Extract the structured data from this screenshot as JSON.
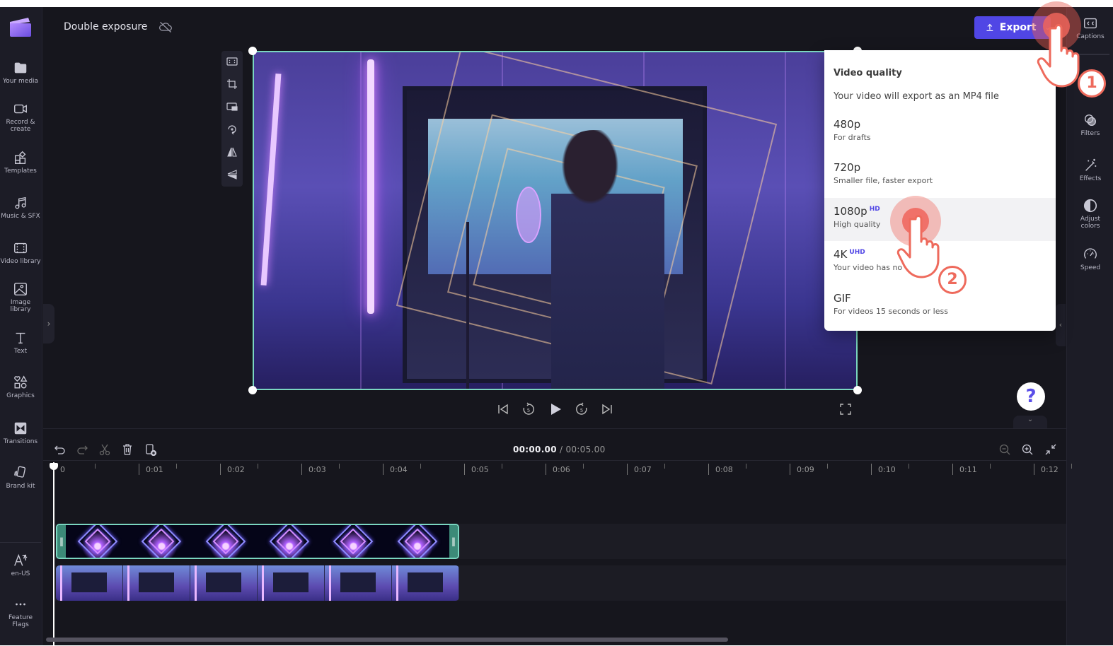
{
  "app": {
    "project_title": "Double exposure",
    "cloud_status_icon": "cloud-off-icon"
  },
  "left_nav": {
    "items": [
      {
        "label": "Your media",
        "icon": "folder-icon"
      },
      {
        "label": "Record & create",
        "icon": "video-camera-icon"
      },
      {
        "label": "Templates",
        "icon": "templates-icon"
      },
      {
        "label": "Music & SFX",
        "icon": "music-note-icon"
      },
      {
        "label": "Video library",
        "icon": "film-icon"
      },
      {
        "label": "Image library",
        "icon": "image-icon"
      },
      {
        "label": "Text",
        "icon": "text-icon"
      },
      {
        "label": "Graphics",
        "icon": "shapes-icon"
      },
      {
        "label": "Transitions",
        "icon": "transitions-icon"
      },
      {
        "label": "Brand kit",
        "icon": "brand-kit-icon"
      }
    ],
    "bottom_items": [
      {
        "label": "en-US",
        "icon": "language-icon"
      },
      {
        "label": "Feature Flags",
        "icon": "more-dots-icon"
      }
    ]
  },
  "header": {
    "export_label": "Export"
  },
  "right_nav": {
    "items": [
      {
        "label": "Captions",
        "icon": "captions-cc-icon"
      },
      {
        "label": "Filters",
        "icon": "filters-icon"
      },
      {
        "label": "Effects",
        "icon": "magic-wand-icon"
      },
      {
        "label": "Adjust colors",
        "icon": "contrast-icon"
      },
      {
        "label": "Speed",
        "icon": "speedometer-icon"
      }
    ]
  },
  "export_menu": {
    "title": "Video quality",
    "subtitle": "Your video will export as an MP4 file",
    "options": [
      {
        "label": "480p",
        "badge": "",
        "description": "For drafts"
      },
      {
        "label": "720p",
        "badge": "",
        "description": "Smaller file, faster export"
      },
      {
        "label": "1080p",
        "badge": "HD",
        "description": "High quality"
      },
      {
        "label": "4K",
        "badge": "UHD",
        "description": "Your video has no"
      },
      {
        "label": "GIF",
        "badge": "",
        "description": "For videos 15 seconds or less"
      }
    ],
    "hovered_option": "1080p"
  },
  "annotations": {
    "step1": "1",
    "step2": "2",
    "accent_color": "#ee6a5c"
  },
  "help": {
    "label": "?"
  },
  "playback": {
    "current_time": "00:00.00",
    "separator": " / ",
    "total_time": "00:05.00"
  },
  "timeline": {
    "ruler_labels": [
      "0",
      "0:01",
      "0:02",
      "0:03",
      "0:04",
      "0:05",
      "0:06",
      "0:07",
      "0:08",
      "0:09",
      "0:10",
      "0:11",
      "0:12"
    ],
    "tracks": [
      {
        "name": "overlay-clip",
        "thumbnails": 6
      },
      {
        "name": "main-video-clip",
        "thumbnails": 6
      }
    ]
  },
  "colors": {
    "accent": "#5046e5",
    "selection": "#7ad6c0",
    "background": "#16161d"
  }
}
